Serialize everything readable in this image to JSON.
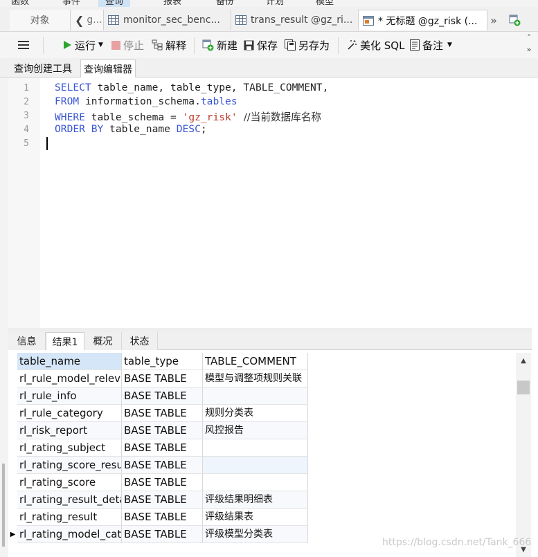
{
  "menubar": {
    "items": [
      {
        "label": "函数"
      },
      {
        "label": "事件"
      },
      {
        "label": "查询",
        "active": true
      },
      {
        "label": "报表"
      },
      {
        "label": "备份"
      },
      {
        "label": "计划"
      },
      {
        "label": "模型"
      }
    ]
  },
  "tabs": {
    "objects": "对象",
    "t1": "g...",
    "t2": "monitor_sec_benc...",
    "t3": "trans_result @gz_ri...",
    "t4": "* 无标题 @gz_risk (..."
  },
  "toolbar": {
    "menu_icon": "hamburger-icon",
    "run": "运行",
    "stop": "停止",
    "explain": "解释",
    "new": "新建",
    "save": "保存",
    "save_as": "另存为",
    "beautify": "美化 SQL",
    "notes": "备注"
  },
  "subtabs": {
    "builder": "查询创建工具",
    "editor": "查询编辑器"
  },
  "editor": {
    "line_numbers": [
      "1",
      "2",
      "3",
      "4",
      "5"
    ],
    "lines": [
      [
        {
          "t": "SELECT",
          "k": "kw"
        },
        {
          "t": " table_name, table_type, TABLE_COMMENT,",
          "k": "id"
        }
      ],
      [
        {
          "t": "FROM",
          "k": "kw"
        },
        {
          "t": " information_schema.",
          "k": "id"
        },
        {
          "t": "tables",
          "k": "kw"
        }
      ],
      [
        {
          "t": "WHERE",
          "k": "kw"
        },
        {
          "t": " table_schema = ",
          "k": "id"
        },
        {
          "t": "'gz_risk'",
          "k": "str"
        },
        {
          "t": "  //当前数据库名称",
          "k": "cmt"
        }
      ],
      [
        {
          "t": "ORDER BY",
          "k": "kw"
        },
        {
          "t": " table_name ",
          "k": "id"
        },
        {
          "t": "DESC",
          "k": "kw"
        },
        {
          "t": ";",
          "k": "id"
        }
      ],
      []
    ]
  },
  "result_tabs": [
    "信息",
    "结果1",
    "概况",
    "状态"
  ],
  "grid": {
    "columns": [
      "table_name",
      "table_type",
      "TABLE_COMMENT"
    ],
    "rows": [
      [
        "rl_rule_model_relevance",
        "BASE TABLE",
        "模型与调整项规则关联"
      ],
      [
        "rl_rule_info",
        "BASE TABLE",
        ""
      ],
      [
        "rl_rule_category",
        "BASE TABLE",
        "规则分类表"
      ],
      [
        "rl_risk_report",
        "BASE TABLE",
        "风控报告"
      ],
      [
        "rl_rating_subject",
        "BASE TABLE",
        ""
      ],
      [
        "rl_rating_score_result",
        "BASE TABLE",
        ""
      ],
      [
        "rl_rating_score",
        "BASE TABLE",
        ""
      ],
      [
        "rl_rating_result_detail",
        "BASE TABLE",
        "评级结果明细表"
      ],
      [
        "rl_rating_result",
        "BASE TABLE",
        "评级结果表"
      ],
      [
        "rl_rating_model_category",
        "BASE TABLE",
        "评级模型分类表"
      ]
    ],
    "current_row": 9
  },
  "watermark": "https://blog.csdn.net/Tank_666",
  "colors": {
    "keyword": "#3a55d4",
    "string": "#c0392b",
    "header_selected": "#d4e6f7"
  }
}
